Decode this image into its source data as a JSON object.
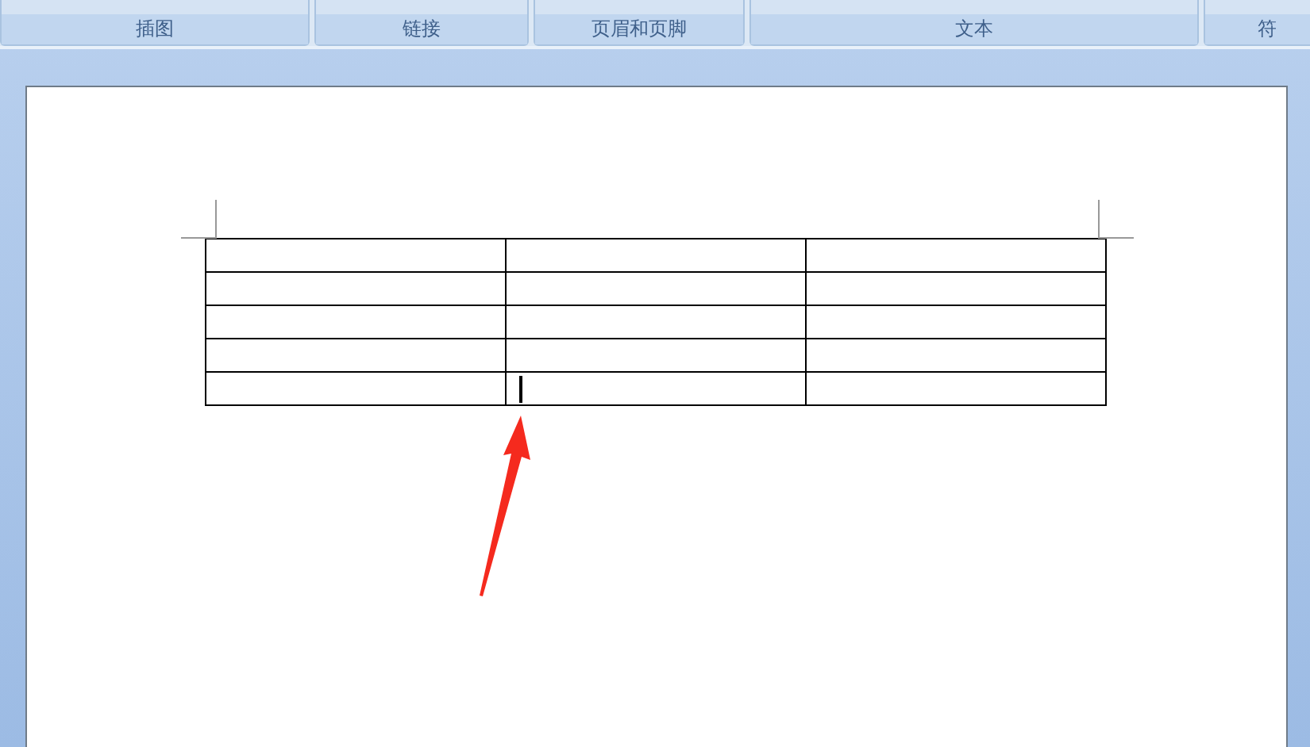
{
  "ribbon": {
    "groups": [
      {
        "label": "插图"
      },
      {
        "label": "链接"
      },
      {
        "label": "页眉和页脚"
      },
      {
        "label": "文本"
      },
      {
        "label": "符"
      }
    ]
  },
  "document": {
    "table": {
      "rows": [
        {
          "cells": [
            {
              "has_cursor": false
            },
            {
              "has_cursor": false
            },
            {
              "has_cursor": false
            }
          ]
        },
        {
          "cells": [
            {
              "has_cursor": false
            },
            {
              "has_cursor": false
            },
            {
              "has_cursor": false
            }
          ]
        },
        {
          "cells": [
            {
              "has_cursor": false
            },
            {
              "has_cursor": false
            },
            {
              "has_cursor": false
            }
          ]
        },
        {
          "cells": [
            {
              "has_cursor": false
            },
            {
              "has_cursor": false
            },
            {
              "has_cursor": false
            }
          ]
        },
        {
          "cells": [
            {
              "has_cursor": false
            },
            {
              "has_cursor": true
            },
            {
              "has_cursor": false
            }
          ]
        }
      ]
    },
    "annotations": [
      {
        "kind": "arrow"
      }
    ]
  }
}
